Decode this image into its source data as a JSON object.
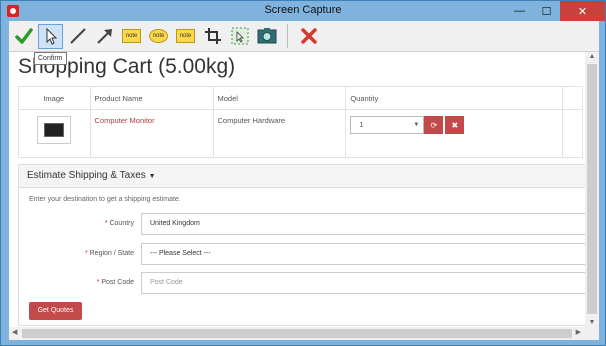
{
  "window": {
    "title": "Screen Capture",
    "minimize": "—",
    "maximize": "☐",
    "close": "✕"
  },
  "toolbar": {
    "tooltip": "Confirm",
    "note_label": "note",
    "icons": [
      "check-icon",
      "pointer-icon",
      "line-icon",
      "arrow-icon",
      "note-rect-icon",
      "note-oval-icon",
      "note-callout-icon",
      "crop-icon",
      "select-region-icon",
      "camera-icon",
      "cancel-icon"
    ]
  },
  "page": {
    "title": "Shopping Cart  (5.00kg)"
  },
  "cart": {
    "columns": [
      "Image",
      "Product Name",
      "Model",
      "Quantity"
    ],
    "rows": [
      {
        "product": "Computer Monitor",
        "model": "Computer Hardware",
        "quantity": "1"
      }
    ]
  },
  "shipping": {
    "heading": "Estimate Shipping & Taxes",
    "note": "Enter your destination to get a shipping estimate.",
    "country_label": "Country",
    "country_value": "United Kingdom",
    "region_label": "Region / State",
    "region_value": "--- Please Select ---",
    "postcode_label": "Post Code",
    "postcode_placeholder": "Post Code",
    "button": "Get Quotes"
  }
}
